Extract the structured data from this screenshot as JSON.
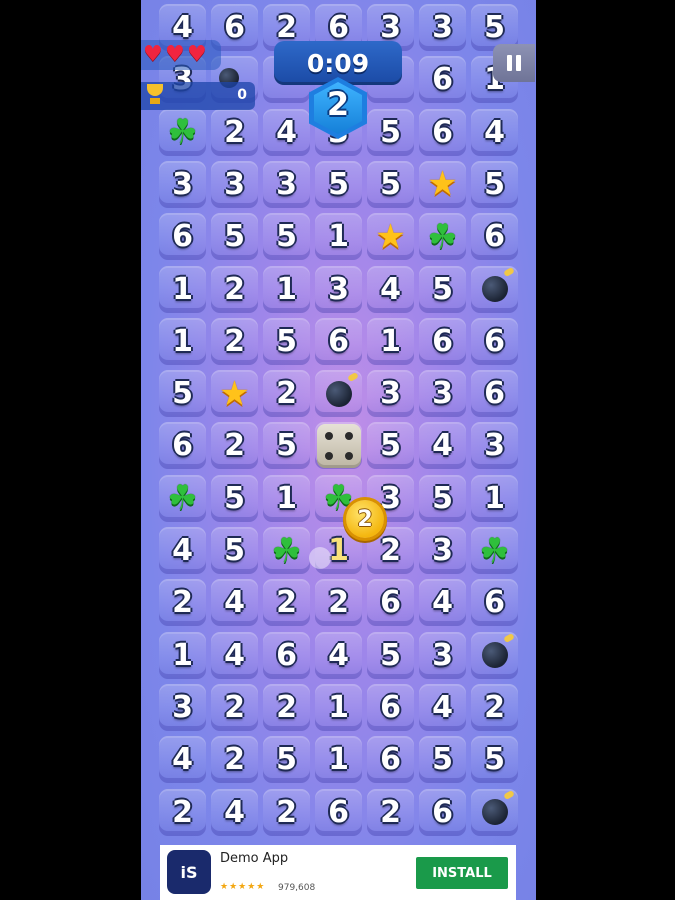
{
  "hud": {
    "timer": "0:09",
    "level": "2",
    "coins": "0"
  },
  "player_token": "2",
  "partial_cell": "1",
  "board": {
    "rows": [
      [
        "4",
        "6",
        "2",
        "6",
        "3",
        "3",
        "5"
      ],
      [
        "3",
        "",
        "",
        "",
        "",
        "6",
        "1"
      ],
      [
        "clover",
        "2",
        "4",
        "3",
        "5",
        "6",
        "4"
      ],
      [
        "3",
        "3",
        "3",
        "5",
        "5",
        "star",
        "5"
      ],
      [
        "6",
        "5",
        "5",
        "1",
        "star",
        "clover",
        "6"
      ],
      [
        "1",
        "2",
        "1",
        "3",
        "4",
        "5",
        "bomb"
      ],
      [
        "1",
        "2",
        "5",
        "6",
        "1",
        "6",
        "6"
      ],
      [
        "5",
        "star",
        "2",
        "bomb",
        "3",
        "3",
        "6"
      ],
      [
        "6",
        "2",
        "5",
        "dice",
        "5",
        "4",
        "3"
      ],
      [
        "clover",
        "5",
        "1",
        "clover",
        "3",
        "5",
        "1"
      ],
      [
        "4",
        "5",
        "clover",
        "",
        "2",
        "3",
        "clover"
      ],
      [
        "2",
        "4",
        "2",
        "2",
        "6",
        "4",
        "6"
      ],
      [
        "1",
        "4",
        "6",
        "4",
        "5",
        "3",
        "bomb"
      ],
      [
        "3",
        "2",
        "2",
        "1",
        "6",
        "4",
        "2"
      ],
      [
        "4",
        "2",
        "5",
        "1",
        "6",
        "5",
        "5"
      ],
      [
        "2",
        "4",
        "2",
        "6",
        "2",
        "6",
        "bomb"
      ]
    ]
  },
  "ad": {
    "app_name": "Demo App",
    "icon_text": "iS",
    "stars": "★★★★★",
    "reviews": "979,608",
    "install_label": "INSTALL"
  }
}
